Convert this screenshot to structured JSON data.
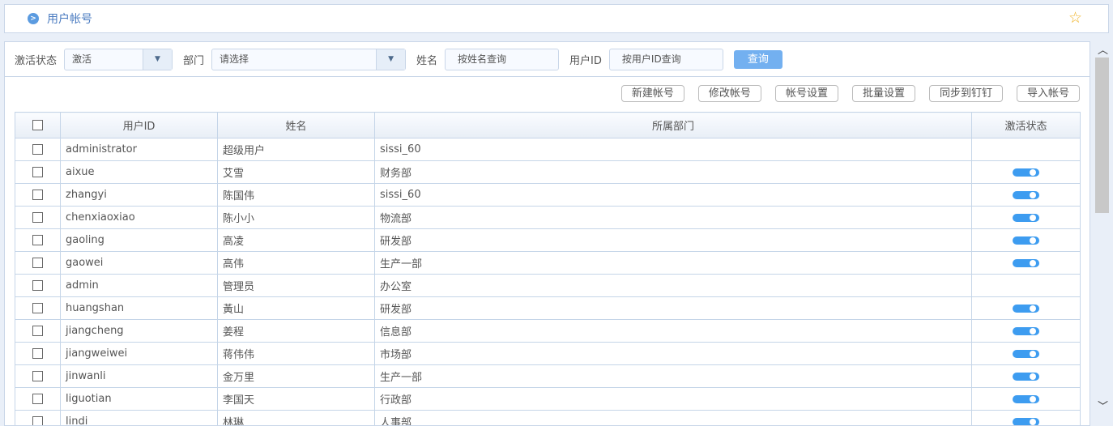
{
  "header": {
    "title": "用户帐号",
    "icon": "chevron-right-circle-icon",
    "favorite_icon": "star-icon"
  },
  "filters": {
    "status_label": "激活状态",
    "status_value": "激活",
    "dept_label": "部门",
    "dept_value": "请选择",
    "name_label": "姓名",
    "name_placeholder": "按姓名查询",
    "userid_label": "用户ID",
    "userid_placeholder": "按用户ID查询",
    "query_button": "查询"
  },
  "actions": [
    "新建帐号",
    "修改帐号",
    "帐号设置",
    "批量设置",
    "同步到钉钉",
    "导入帐号"
  ],
  "table": {
    "columns": [
      "用户ID",
      "姓名",
      "所属部门",
      "激活状态"
    ],
    "rows": [
      {
        "id": "administrator",
        "name": "超级用户",
        "dept": "sissi_60",
        "active": false
      },
      {
        "id": "aixue",
        "name": "艾雪",
        "dept": "财务部",
        "active": true
      },
      {
        "id": "zhangyi",
        "name": "陈国伟",
        "dept": "sissi_60",
        "active": true
      },
      {
        "id": "chenxiaoxiao",
        "name": "陈小小",
        "dept": "物流部",
        "active": true
      },
      {
        "id": "gaoling",
        "name": "高凌",
        "dept": "研发部",
        "active": true
      },
      {
        "id": "gaowei",
        "name": "高伟",
        "dept": "生产一部",
        "active": true
      },
      {
        "id": "admin",
        "name": "管理员",
        "dept": "办公室",
        "active": false
      },
      {
        "id": "huangshan",
        "name": "黃山",
        "dept": "研发部",
        "active": true
      },
      {
        "id": "jiangcheng",
        "name": "姜程",
        "dept": "信息部",
        "active": true
      },
      {
        "id": "jiangweiwei",
        "name": "蒋伟伟",
        "dept": "市场部",
        "active": true
      },
      {
        "id": "jinwanli",
        "name": "金万里",
        "dept": "生产一部",
        "active": true
      },
      {
        "id": "liguotian",
        "name": "李国天",
        "dept": "行政部",
        "active": true
      },
      {
        "id": "lindi",
        "name": "林琳",
        "dept": "人事部",
        "active": true
      }
    ]
  },
  "colors": {
    "accent": "#3d9cf0",
    "query_button": "#73b0f0",
    "border": "#c5d5e8"
  }
}
